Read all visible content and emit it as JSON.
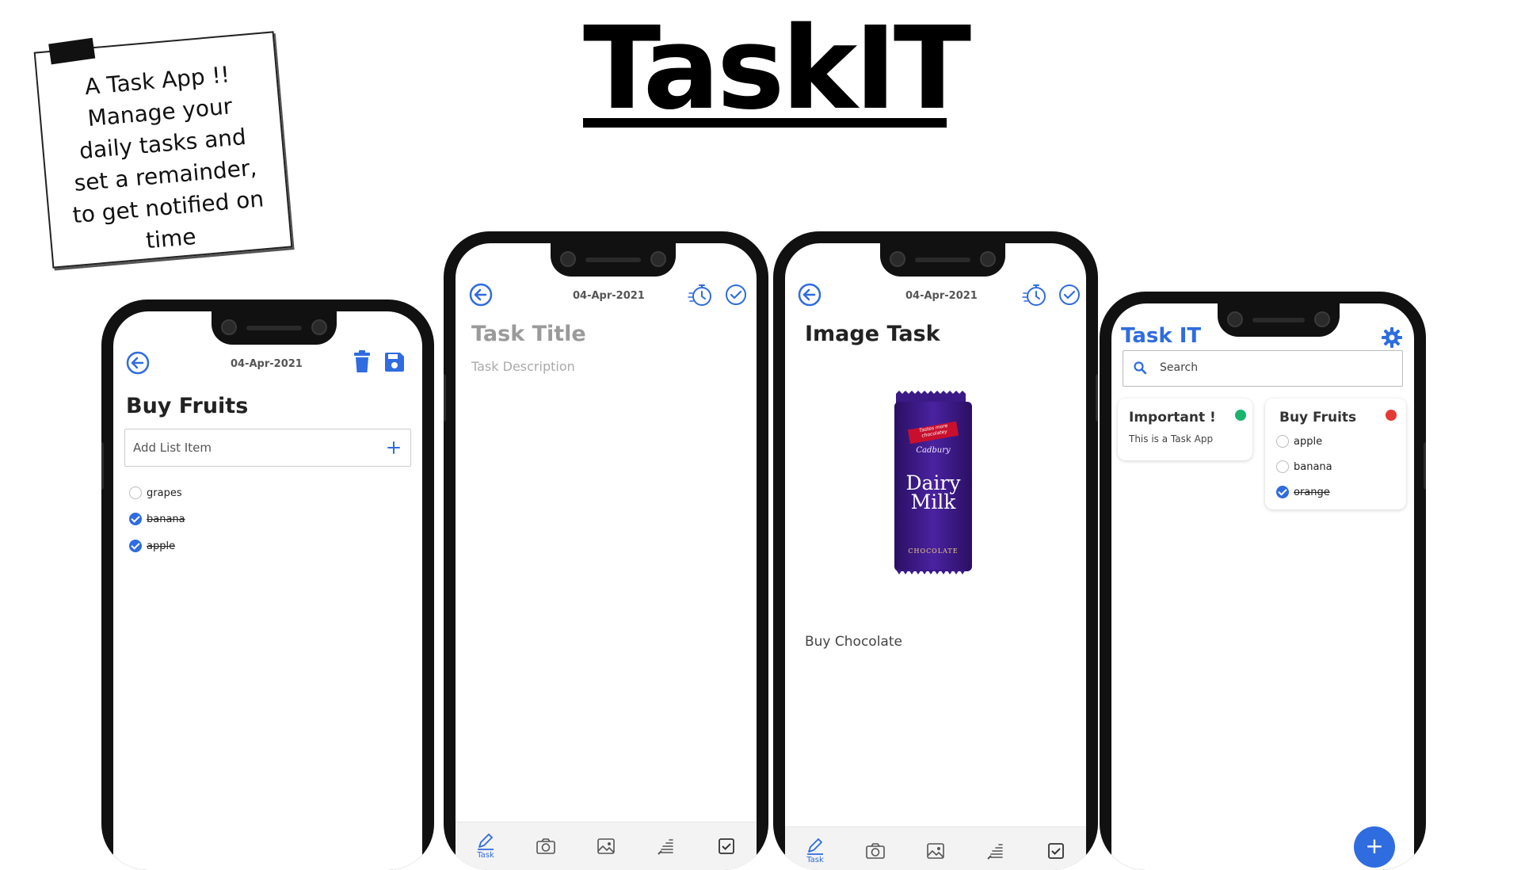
{
  "header": {
    "title": "TaskIT"
  },
  "note": {
    "text": "A Task App !!\nManage your\ndaily tasks and\nset a remainder,\nto get notified on\ntime"
  },
  "colors": {
    "accent": "#2f6ce0",
    "green": "#19b46e",
    "red": "#e53935"
  },
  "phone1": {
    "date": "04-Apr-2021",
    "title": "Buy Fruits",
    "add_placeholder": "Add List Item",
    "items": [
      {
        "label": "grapes",
        "checked": false
      },
      {
        "label": "banana",
        "checked": true
      },
      {
        "label": "apple",
        "checked": true
      }
    ],
    "icons": [
      "back-arrow-icon",
      "trash-icon",
      "save-icon",
      "plus-icon"
    ]
  },
  "phone2": {
    "date": "04-Apr-2021",
    "title_placeholder": "Task Title",
    "desc_placeholder": "Task Description",
    "bottom_bar": [
      {
        "icon": "edit-icon",
        "label": "Task"
      },
      {
        "icon": "camera-icon",
        "label": ""
      },
      {
        "icon": "image-icon",
        "label": ""
      },
      {
        "icon": "brush-icon",
        "label": ""
      },
      {
        "icon": "checkbox-icon",
        "label": ""
      }
    ]
  },
  "phone3": {
    "date": "04-Apr-2021",
    "title": "Image Task",
    "description": "Buy Chocolate",
    "image": {
      "brand": "Cadbury",
      "product_line1": "Dairy",
      "product_line2": "Milk",
      "tagline": "CHOCOLATE",
      "banner": "Tastes more chocolatey"
    },
    "bottom_bar": [
      {
        "icon": "edit-icon",
        "label": "Task"
      },
      {
        "icon": "camera-icon",
        "label": ""
      },
      {
        "icon": "image-icon",
        "label": ""
      },
      {
        "icon": "brush-icon",
        "label": ""
      },
      {
        "icon": "checkbox-icon",
        "label": ""
      }
    ]
  },
  "phone4": {
    "app_title": "Task IT",
    "search_placeholder": "Search",
    "cards": [
      {
        "title": "Important !",
        "subtitle": "This is a Task App",
        "dot": "green"
      },
      {
        "title": "Buy Fruits",
        "dot": "red",
        "items": [
          {
            "label": "apple",
            "checked": false
          },
          {
            "label": "banana",
            "checked": false
          },
          {
            "label": "orange",
            "checked": true
          }
        ]
      }
    ],
    "fab": "+"
  }
}
